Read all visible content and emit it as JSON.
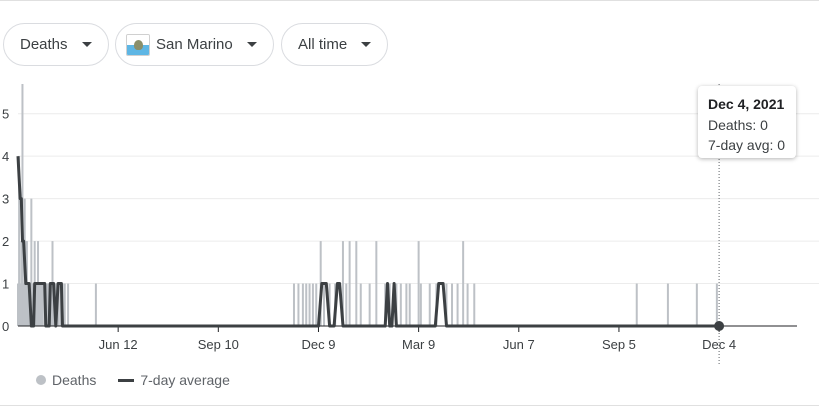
{
  "filters": {
    "metric": "Deaths",
    "location": "San Marino",
    "time_range": "All time"
  },
  "tooltip": {
    "date": "Dec 4, 2021",
    "deaths_line": "Deaths: 0",
    "avg_line": "7-day avg: 0"
  },
  "legend": {
    "deaths": "Deaths",
    "average": "7-day average"
  },
  "colors": {
    "bars": "#bdc1c6",
    "average_line": "#3c4043",
    "grid": "#ececec",
    "axis": "#202124"
  },
  "chart_data": {
    "type": "bar",
    "x_tick_labels": [
      "Jun 12",
      "Sep 10",
      "Dec 9",
      "Mar 9",
      "Jun 7",
      "Sep 5",
      "Dec 4"
    ],
    "y_ticks": [
      0,
      1,
      2,
      3,
      4,
      5
    ],
    "ylim": [
      0,
      5.7
    ],
    "x_range_days": [
      0,
      700
    ],
    "tick_days": [
      90,
      180,
      270,
      360,
      450,
      540,
      630
    ],
    "hover_day": 630,
    "series": [
      {
        "name": "Deaths",
        "type": "bar",
        "points": [
          [
            0,
            1
          ],
          [
            1,
            4
          ],
          [
            2,
            1
          ],
          [
            3,
            2
          ],
          [
            4,
            6
          ],
          [
            5,
            1
          ],
          [
            6,
            3
          ],
          [
            7,
            2
          ],
          [
            8,
            2
          ],
          [
            9,
            1
          ],
          [
            10,
            1
          ],
          [
            11,
            1
          ],
          [
            12,
            3
          ],
          [
            13,
            1
          ],
          [
            14,
            1
          ],
          [
            15,
            2
          ],
          [
            16,
            1
          ],
          [
            17,
            1
          ],
          [
            18,
            2
          ],
          [
            19,
            1
          ],
          [
            20,
            1
          ],
          [
            21,
            1
          ],
          [
            22,
            1
          ],
          [
            24,
            1
          ],
          [
            26,
            1
          ],
          [
            27,
            1
          ],
          [
            28,
            1
          ],
          [
            29,
            1
          ],
          [
            30,
            1
          ],
          [
            31,
            2
          ],
          [
            32,
            1
          ],
          [
            33,
            1
          ],
          [
            34,
            1
          ],
          [
            35,
            1
          ],
          [
            36,
            1
          ],
          [
            38,
            1
          ],
          [
            40,
            1
          ],
          [
            42,
            1
          ],
          [
            45,
            1
          ],
          [
            70,
            1
          ],
          [
            248,
            1
          ],
          [
            252,
            1
          ],
          [
            256,
            1
          ],
          [
            259,
            1
          ],
          [
            262,
            1
          ],
          [
            265,
            1
          ],
          [
            268,
            1
          ],
          [
            272,
            2
          ],
          [
            275,
            1
          ],
          [
            280,
            1
          ],
          [
            285,
            1
          ],
          [
            292,
            2
          ],
          [
            295,
            1
          ],
          [
            298,
            2
          ],
          [
            304,
            2
          ],
          [
            308,
            1
          ],
          [
            316,
            1
          ],
          [
            322,
            2
          ],
          [
            330,
            1
          ],
          [
            334,
            1
          ],
          [
            340,
            1
          ],
          [
            344,
            1
          ],
          [
            349,
            1
          ],
          [
            352,
            1
          ],
          [
            360,
            2
          ],
          [
            362,
            1
          ],
          [
            370,
            1
          ],
          [
            376,
            1
          ],
          [
            385,
            1
          ],
          [
            390,
            1
          ],
          [
            395,
            1
          ],
          [
            400,
            2
          ],
          [
            404,
            1
          ],
          [
            410,
            1
          ],
          [
            556,
            1
          ],
          [
            584,
            1
          ],
          [
            610,
            1
          ],
          [
            628,
            1
          ]
        ]
      },
      {
        "name": "7-day average",
        "type": "line",
        "points": [
          [
            0,
            4
          ],
          [
            2,
            3
          ],
          [
            3,
            3
          ],
          [
            4,
            2
          ],
          [
            5,
            2
          ],
          [
            7,
            1
          ],
          [
            10,
            1
          ],
          [
            12,
            0
          ],
          [
            14,
            0
          ],
          [
            15,
            1
          ],
          [
            23,
            1
          ],
          [
            24,
            1
          ],
          [
            25,
            0
          ],
          [
            28,
            0
          ],
          [
            29,
            1
          ],
          [
            32,
            1
          ],
          [
            34,
            0
          ],
          [
            36,
            1
          ],
          [
            39,
            1
          ],
          [
            40,
            0
          ],
          [
            41,
            0
          ],
          [
            42,
            0
          ],
          [
            46,
            0
          ],
          [
            50,
            0
          ],
          [
            270,
            0
          ],
          [
            273,
            1
          ],
          [
            277,
            1
          ],
          [
            280,
            0
          ],
          [
            284,
            0
          ],
          [
            287,
            1
          ],
          [
            289,
            1
          ],
          [
            292,
            0
          ],
          [
            308,
            0
          ],
          [
            330,
            0
          ],
          [
            332,
            1
          ],
          [
            334,
            0
          ],
          [
            336,
            0
          ],
          [
            338,
            1
          ],
          [
            340,
            0
          ],
          [
            375,
            0
          ],
          [
            378,
            1
          ],
          [
            382,
            1
          ],
          [
            385,
            0
          ],
          [
            630,
            0
          ]
        ]
      }
    ]
  }
}
